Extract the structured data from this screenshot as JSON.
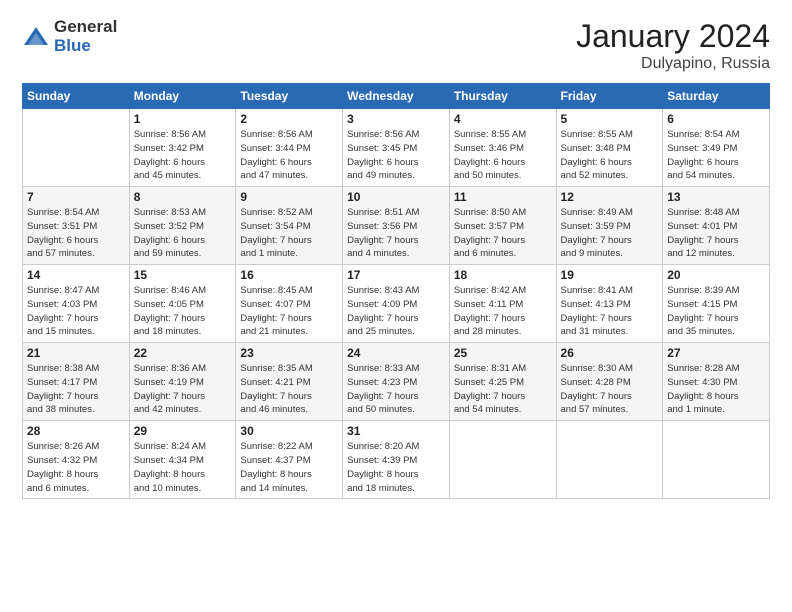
{
  "logo": {
    "general": "General",
    "blue": "Blue"
  },
  "title": {
    "month": "January 2024",
    "location": "Dulyapino, Russia"
  },
  "header_days": [
    "Sunday",
    "Monday",
    "Tuesday",
    "Wednesday",
    "Thursday",
    "Friday",
    "Saturday"
  ],
  "weeks": [
    [
      {
        "day": "",
        "info": ""
      },
      {
        "day": "1",
        "info": "Sunrise: 8:56 AM\nSunset: 3:42 PM\nDaylight: 6 hours\nand 45 minutes."
      },
      {
        "day": "2",
        "info": "Sunrise: 8:56 AM\nSunset: 3:44 PM\nDaylight: 6 hours\nand 47 minutes."
      },
      {
        "day": "3",
        "info": "Sunrise: 8:56 AM\nSunset: 3:45 PM\nDaylight: 6 hours\nand 49 minutes."
      },
      {
        "day": "4",
        "info": "Sunrise: 8:55 AM\nSunset: 3:46 PM\nDaylight: 6 hours\nand 50 minutes."
      },
      {
        "day": "5",
        "info": "Sunrise: 8:55 AM\nSunset: 3:48 PM\nDaylight: 6 hours\nand 52 minutes."
      },
      {
        "day": "6",
        "info": "Sunrise: 8:54 AM\nSunset: 3:49 PM\nDaylight: 6 hours\nand 54 minutes."
      }
    ],
    [
      {
        "day": "7",
        "info": "Sunrise: 8:54 AM\nSunset: 3:51 PM\nDaylight: 6 hours\nand 57 minutes."
      },
      {
        "day": "8",
        "info": "Sunrise: 8:53 AM\nSunset: 3:52 PM\nDaylight: 6 hours\nand 59 minutes."
      },
      {
        "day": "9",
        "info": "Sunrise: 8:52 AM\nSunset: 3:54 PM\nDaylight: 7 hours\nand 1 minute."
      },
      {
        "day": "10",
        "info": "Sunrise: 8:51 AM\nSunset: 3:56 PM\nDaylight: 7 hours\nand 4 minutes."
      },
      {
        "day": "11",
        "info": "Sunrise: 8:50 AM\nSunset: 3:57 PM\nDaylight: 7 hours\nand 6 minutes."
      },
      {
        "day": "12",
        "info": "Sunrise: 8:49 AM\nSunset: 3:59 PM\nDaylight: 7 hours\nand 9 minutes."
      },
      {
        "day": "13",
        "info": "Sunrise: 8:48 AM\nSunset: 4:01 PM\nDaylight: 7 hours\nand 12 minutes."
      }
    ],
    [
      {
        "day": "14",
        "info": "Sunrise: 8:47 AM\nSunset: 4:03 PM\nDaylight: 7 hours\nand 15 minutes."
      },
      {
        "day": "15",
        "info": "Sunrise: 8:46 AM\nSunset: 4:05 PM\nDaylight: 7 hours\nand 18 minutes."
      },
      {
        "day": "16",
        "info": "Sunrise: 8:45 AM\nSunset: 4:07 PM\nDaylight: 7 hours\nand 21 minutes."
      },
      {
        "day": "17",
        "info": "Sunrise: 8:43 AM\nSunset: 4:09 PM\nDaylight: 7 hours\nand 25 minutes."
      },
      {
        "day": "18",
        "info": "Sunrise: 8:42 AM\nSunset: 4:11 PM\nDaylight: 7 hours\nand 28 minutes."
      },
      {
        "day": "19",
        "info": "Sunrise: 8:41 AM\nSunset: 4:13 PM\nDaylight: 7 hours\nand 31 minutes."
      },
      {
        "day": "20",
        "info": "Sunrise: 8:39 AM\nSunset: 4:15 PM\nDaylight: 7 hours\nand 35 minutes."
      }
    ],
    [
      {
        "day": "21",
        "info": "Sunrise: 8:38 AM\nSunset: 4:17 PM\nDaylight: 7 hours\nand 38 minutes."
      },
      {
        "day": "22",
        "info": "Sunrise: 8:36 AM\nSunset: 4:19 PM\nDaylight: 7 hours\nand 42 minutes."
      },
      {
        "day": "23",
        "info": "Sunrise: 8:35 AM\nSunset: 4:21 PM\nDaylight: 7 hours\nand 46 minutes."
      },
      {
        "day": "24",
        "info": "Sunrise: 8:33 AM\nSunset: 4:23 PM\nDaylight: 7 hours\nand 50 minutes."
      },
      {
        "day": "25",
        "info": "Sunrise: 8:31 AM\nSunset: 4:25 PM\nDaylight: 7 hours\nand 54 minutes."
      },
      {
        "day": "26",
        "info": "Sunrise: 8:30 AM\nSunset: 4:28 PM\nDaylight: 7 hours\nand 57 minutes."
      },
      {
        "day": "27",
        "info": "Sunrise: 8:28 AM\nSunset: 4:30 PM\nDaylight: 8 hours\nand 1 minute."
      }
    ],
    [
      {
        "day": "28",
        "info": "Sunrise: 8:26 AM\nSunset: 4:32 PM\nDaylight: 8 hours\nand 6 minutes."
      },
      {
        "day": "29",
        "info": "Sunrise: 8:24 AM\nSunset: 4:34 PM\nDaylight: 8 hours\nand 10 minutes."
      },
      {
        "day": "30",
        "info": "Sunrise: 8:22 AM\nSunset: 4:37 PM\nDaylight: 8 hours\nand 14 minutes."
      },
      {
        "day": "31",
        "info": "Sunrise: 8:20 AM\nSunset: 4:39 PM\nDaylight: 8 hours\nand 18 minutes."
      },
      {
        "day": "",
        "info": ""
      },
      {
        "day": "",
        "info": ""
      },
      {
        "day": "",
        "info": ""
      }
    ]
  ]
}
